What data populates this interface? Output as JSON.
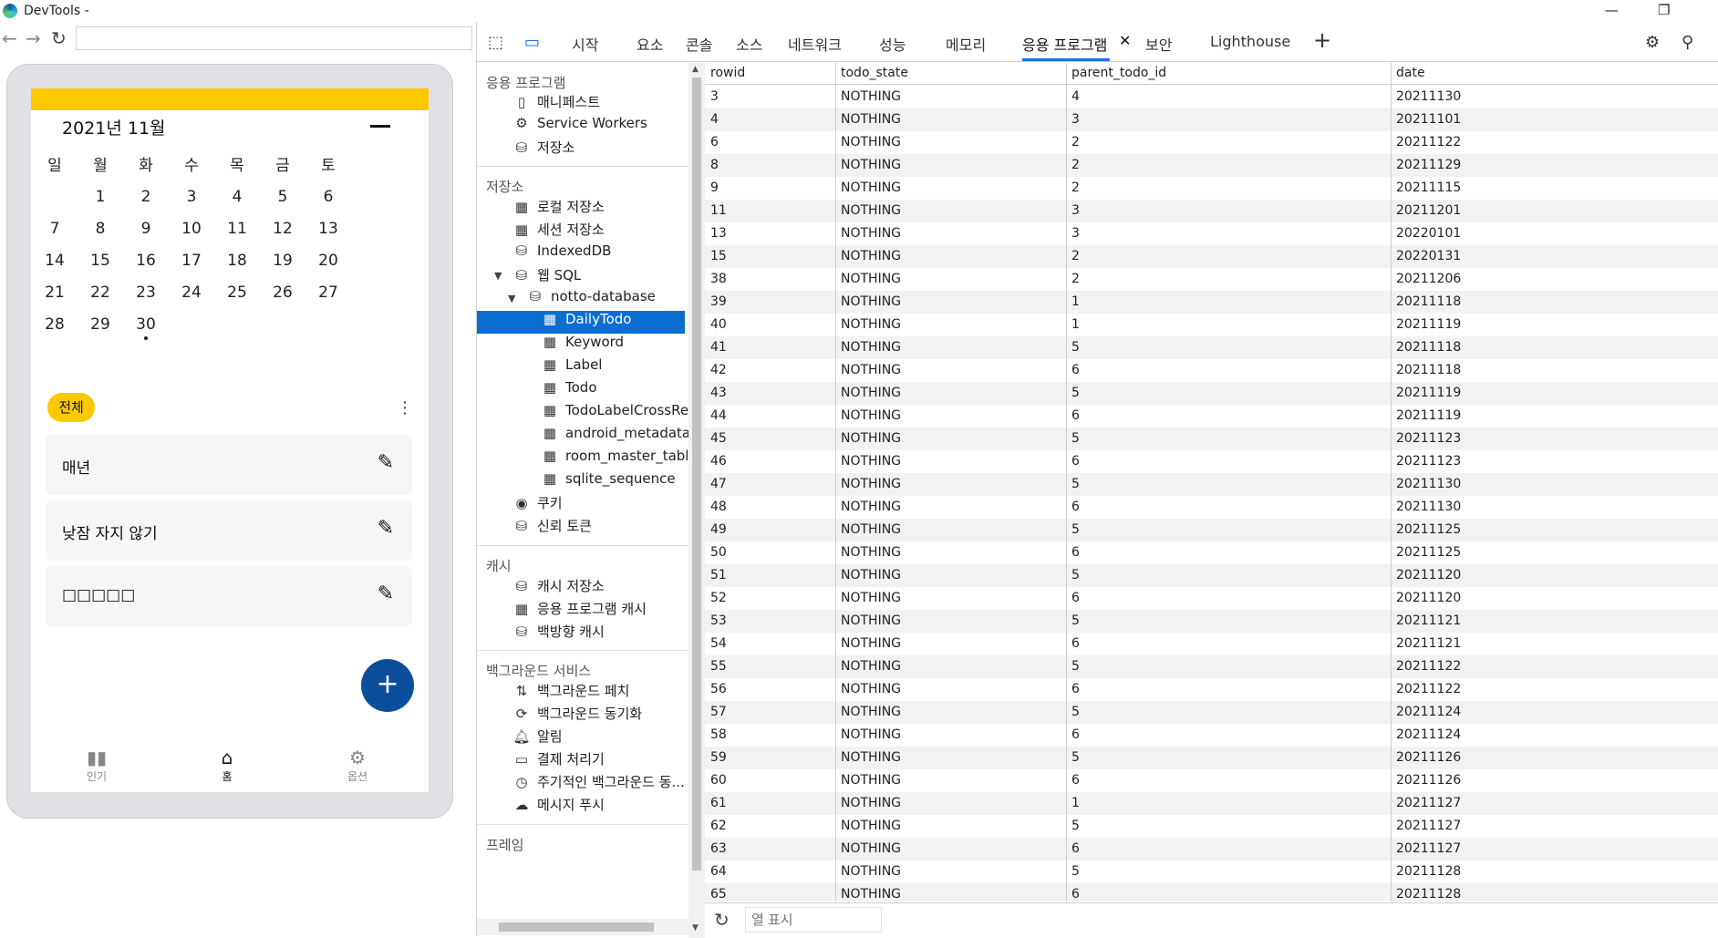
{
  "window": {
    "title": "DevTools -"
  },
  "icons": {
    "back": "arrow-left-icon",
    "forward": "arrow-right-icon",
    "reload": "reload-icon"
  },
  "app": {
    "month_title": "2021년 11월",
    "weekdays": [
      "일",
      "월",
      "화",
      "수",
      "목",
      "금",
      "토"
    ],
    "weeks": [
      [
        "",
        "1",
        "2",
        "3",
        "4",
        "5",
        "6"
      ],
      [
        "7",
        "8",
        "9",
        "10",
        "11",
        "12",
        "13"
      ],
      [
        "14",
        "15",
        "16",
        "17",
        "18",
        "19",
        "20"
      ],
      [
        "21",
        "22",
        "23",
        "24",
        "25",
        "26",
        "27"
      ],
      [
        "28",
        "29",
        "30",
        "",
        "",
        "",
        ""
      ]
    ],
    "filter_chip": "전체",
    "todos": [
      "매년",
      "낮잠 자지 않기",
      "□□□□□"
    ],
    "fab_label": "+",
    "bottom_nav": [
      {
        "label": "인기",
        "icon": "bar-chart-icon"
      },
      {
        "label": "홈",
        "icon": "home-icon",
        "active": true
      },
      {
        "label": "옵션",
        "icon": "gear-icon"
      }
    ]
  },
  "devtools": {
    "tabs": [
      "시작",
      "요소",
      "콘솔",
      "소스",
      "네트워크",
      "성능",
      "메모리",
      "응용 프로그램",
      "보안",
      "Lighthouse"
    ],
    "active_tab": "응용 프로그램",
    "sidebar": {
      "app_section": "응용 프로그램",
      "app_items": [
        "매니페스트",
        "Service Workers",
        "저장소"
      ],
      "storage_section": "저장소",
      "storage_items": [
        "로컬 저장소",
        "세션 저장소",
        "IndexedDB",
        "웹 SQL",
        "notto-database"
      ],
      "tables": [
        "DailyTodo",
        "Keyword",
        "Label",
        "Todo",
        "TodoLabelCrossRef",
        "android_metadata",
        "room_master_table",
        "sqlite_sequence"
      ],
      "selected_table": "DailyTodo",
      "storage_more": [
        "쿠키",
        "신뢰 토큰"
      ],
      "cache_section": "캐시",
      "cache_items": [
        "캐시 저장소",
        "응용 프로그램 캐시",
        "백방향 캐시"
      ],
      "bg_section": "백그라운드 서비스",
      "bg_items": [
        "백그라운드 페치",
        "백그라운드 동기화",
        "알림",
        "결제 처리기",
        "주기적인 백그라운드 동...",
        "메시지 푸시"
      ],
      "frames_section": "프레임"
    },
    "table": {
      "columns": [
        "rowid",
        "todo_state",
        "parent_todo_id",
        "date"
      ],
      "rows": [
        [
          "3",
          "NOTHING",
          "4",
          "20211130"
        ],
        [
          "4",
          "NOTHING",
          "3",
          "20211101"
        ],
        [
          "6",
          "NOTHING",
          "2",
          "20211122"
        ],
        [
          "8",
          "NOTHING",
          "2",
          "20211129"
        ],
        [
          "9",
          "NOTHING",
          "2",
          "20211115"
        ],
        [
          "11",
          "NOTHING",
          "3",
          "20211201"
        ],
        [
          "13",
          "NOTHING",
          "3",
          "20220101"
        ],
        [
          "15",
          "NOTHING",
          "2",
          "20220131"
        ],
        [
          "38",
          "NOTHING",
          "2",
          "20211206"
        ],
        [
          "39",
          "NOTHING",
          "1",
          "20211118"
        ],
        [
          "40",
          "NOTHING",
          "1",
          "20211119"
        ],
        [
          "41",
          "NOTHING",
          "5",
          "20211118"
        ],
        [
          "42",
          "NOTHING",
          "6",
          "20211118"
        ],
        [
          "43",
          "NOTHING",
          "5",
          "20211119"
        ],
        [
          "44",
          "NOTHING",
          "6",
          "20211119"
        ],
        [
          "45",
          "NOTHING",
          "5",
          "20211123"
        ],
        [
          "46",
          "NOTHING",
          "6",
          "20211123"
        ],
        [
          "47",
          "NOTHING",
          "5",
          "20211130"
        ],
        [
          "48",
          "NOTHING",
          "6",
          "20211130"
        ],
        [
          "49",
          "NOTHING",
          "5",
          "20211125"
        ],
        [
          "50",
          "NOTHING",
          "6",
          "20211125"
        ],
        [
          "51",
          "NOTHING",
          "5",
          "20211120"
        ],
        [
          "52",
          "NOTHING",
          "6",
          "20211120"
        ],
        [
          "53",
          "NOTHING",
          "5",
          "20211121"
        ],
        [
          "54",
          "NOTHING",
          "6",
          "20211121"
        ],
        [
          "55",
          "NOTHING",
          "5",
          "20211122"
        ],
        [
          "56",
          "NOTHING",
          "6",
          "20211122"
        ],
        [
          "57",
          "NOTHING",
          "5",
          "20211124"
        ],
        [
          "58",
          "NOTHING",
          "6",
          "20211124"
        ],
        [
          "59",
          "NOTHING",
          "5",
          "20211126"
        ],
        [
          "60",
          "NOTHING",
          "6",
          "20211126"
        ],
        [
          "61",
          "NOTHING",
          "1",
          "20211127"
        ],
        [
          "62",
          "NOTHING",
          "5",
          "20211127"
        ],
        [
          "63",
          "NOTHING",
          "6",
          "20211127"
        ],
        [
          "64",
          "NOTHING",
          "5",
          "20211128"
        ],
        [
          "65",
          "NOTHING",
          "6",
          "20211128"
        ]
      ]
    },
    "filter_placeholder": "열 표시"
  }
}
